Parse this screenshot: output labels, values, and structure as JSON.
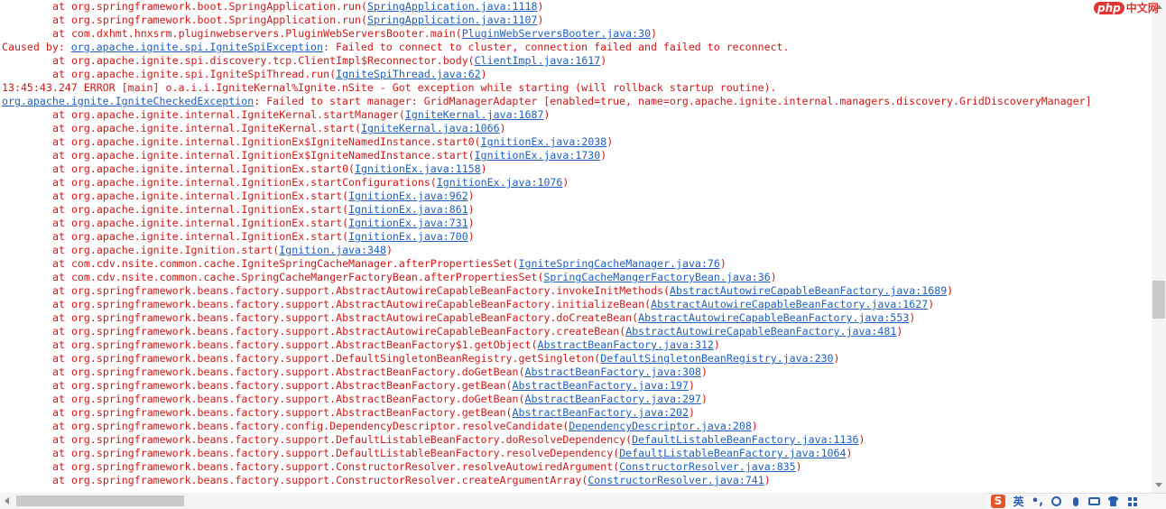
{
  "console": {
    "lines": [
      {
        "indent": true,
        "text": "at org.springframework.boot.SpringApplication.run(",
        "link": "SpringApplication.java:1118",
        "after": ")"
      },
      {
        "indent": true,
        "text": "at org.springframework.boot.SpringApplication.run(",
        "link": "SpringApplication.java:1107",
        "after": ")"
      },
      {
        "indent": true,
        "text": "at com.dxhmt.hnxsrm.pluginwebservers.PluginWebServersBooter.main(",
        "link": "PluginWebServersBooter.java:30",
        "after": ")"
      },
      {
        "indent": false,
        "text": "Caused by: ",
        "link": "org.apache.ignite.spi.IgniteSpiException",
        "after": ": Failed to connect to cluster, connection failed and failed to reconnect."
      },
      {
        "indent": true,
        "text": "at org.apache.ignite.spi.discovery.tcp.ClientImpl$Reconnector.body(",
        "link": "ClientImpl.java:1617",
        "after": ")"
      },
      {
        "indent": true,
        "text": "at org.apache.ignite.spi.IgniteSpiThread.run(",
        "link": "IgniteSpiThread.java:62",
        "after": ")"
      },
      {
        "indent": false,
        "text": "13:45:43.247 ERROR [main] o.a.i.i.IgniteKernal%Ignite.nSite - Got exception while starting (will rollback startup routine).",
        "link": "",
        "after": ""
      },
      {
        "indent": false,
        "text": "",
        "link": "org.apache.ignite.IgniteCheckedException",
        "after": ": Failed to start manager: GridManagerAdapter [enabled=true, name=org.apache.ignite.internal.managers.discovery.GridDiscoveryManager]"
      },
      {
        "indent": true,
        "text": "at org.apache.ignite.internal.IgniteKernal.startManager(",
        "link": "IgniteKernal.java:1687",
        "after": ")"
      },
      {
        "indent": true,
        "text": "at org.apache.ignite.internal.IgniteKernal.start(",
        "link": "IgniteKernal.java:1066",
        "after": ")"
      },
      {
        "indent": true,
        "text": "at org.apache.ignite.internal.IgnitionEx$IgniteNamedInstance.start0(",
        "link": "IgnitionEx.java:2038",
        "after": ")"
      },
      {
        "indent": true,
        "text": "at org.apache.ignite.internal.IgnitionEx$IgniteNamedInstance.start(",
        "link": "IgnitionEx.java:1730",
        "after": ")"
      },
      {
        "indent": true,
        "text": "at org.apache.ignite.internal.IgnitionEx.start0(",
        "link": "IgnitionEx.java:1158",
        "after": ")"
      },
      {
        "indent": true,
        "text": "at org.apache.ignite.internal.IgnitionEx.startConfigurations(",
        "link": "IgnitionEx.java:1076",
        "after": ")"
      },
      {
        "indent": true,
        "text": "at org.apache.ignite.internal.IgnitionEx.start(",
        "link": "IgnitionEx.java:962",
        "after": ")"
      },
      {
        "indent": true,
        "text": "at org.apache.ignite.internal.IgnitionEx.start(",
        "link": "IgnitionEx.java:861",
        "after": ")"
      },
      {
        "indent": true,
        "text": "at org.apache.ignite.internal.IgnitionEx.start(",
        "link": "IgnitionEx.java:731",
        "after": ")"
      },
      {
        "indent": true,
        "text": "at org.apache.ignite.internal.IgnitionEx.start(",
        "link": "IgnitionEx.java:700",
        "after": ")"
      },
      {
        "indent": true,
        "text": "at org.apache.ignite.Ignition.start(",
        "link": "Ignition.java:348",
        "after": ")"
      },
      {
        "indent": true,
        "text": "at com.cdv.nsite.common.cache.IgniteSpringCacheManager.afterPropertiesSet(",
        "link": "IgniteSpringCacheManager.java:76",
        "after": ")"
      },
      {
        "indent": true,
        "text": "at com.cdv.nsite.common.cache.SpringCacheMangerFactoryBean.afterPropertiesSet(",
        "link": "SpringCacheMangerFactoryBean.java:36",
        "after": ")"
      },
      {
        "indent": true,
        "text": "at org.springframework.beans.factory.support.AbstractAutowireCapableBeanFactory.invokeInitMethods(",
        "link": "AbstractAutowireCapableBeanFactory.java:1689",
        "after": ")"
      },
      {
        "indent": true,
        "text": "at org.springframework.beans.factory.support.AbstractAutowireCapableBeanFactory.initializeBean(",
        "link": "AbstractAutowireCapableBeanFactory.java:1627",
        "after": ")"
      },
      {
        "indent": true,
        "text": "at org.springframework.beans.factory.support.AbstractAutowireCapableBeanFactory.doCreateBean(",
        "link": "AbstractAutowireCapableBeanFactory.java:553",
        "after": ")"
      },
      {
        "indent": true,
        "text": "at org.springframework.beans.factory.support.AbstractAutowireCapableBeanFactory.createBean(",
        "link": "AbstractAutowireCapableBeanFactory.java:481",
        "after": ")"
      },
      {
        "indent": true,
        "text": "at org.springframework.beans.factory.support.AbstractBeanFactory$1.getObject(",
        "link": "AbstractBeanFactory.java:312",
        "after": ")"
      },
      {
        "indent": true,
        "text": "at org.springframework.beans.factory.support.DefaultSingletonBeanRegistry.getSingleton(",
        "link": "DefaultSingletonBeanRegistry.java:230",
        "after": ")"
      },
      {
        "indent": true,
        "text": "at org.springframework.beans.factory.support.AbstractBeanFactory.doGetBean(",
        "link": "AbstractBeanFactory.java:308",
        "after": ")"
      },
      {
        "indent": true,
        "text": "at org.springframework.beans.factory.support.AbstractBeanFactory.getBean(",
        "link": "AbstractBeanFactory.java:197",
        "after": ")"
      },
      {
        "indent": true,
        "text": "at org.springframework.beans.factory.support.AbstractBeanFactory.doGetBean(",
        "link": "AbstractBeanFactory.java:297",
        "after": ")"
      },
      {
        "indent": true,
        "text": "at org.springframework.beans.factory.support.AbstractBeanFactory.getBean(",
        "link": "AbstractBeanFactory.java:202",
        "after": ")"
      },
      {
        "indent": true,
        "text": "at org.springframework.beans.factory.config.DependencyDescriptor.resolveCandidate(",
        "link": "DependencyDescriptor.java:208",
        "after": ")"
      },
      {
        "indent": true,
        "text": "at org.springframework.beans.factory.support.DefaultListableBeanFactory.doResolveDependency(",
        "link": "DefaultListableBeanFactory.java:1136",
        "after": ")"
      },
      {
        "indent": true,
        "text": "at org.springframework.beans.factory.support.DefaultListableBeanFactory.resolveDependency(",
        "link": "DefaultListableBeanFactory.java:1064",
        "after": ")"
      },
      {
        "indent": true,
        "text": "at org.springframework.beans.factory.support.ConstructorResolver.resolveAutowiredArgument(",
        "link": "ConstructorResolver.java:835",
        "after": ")"
      },
      {
        "indent": true,
        "text": "at org.springframework.beans.factory.support.ConstructorResolver.createArgumentArray(",
        "link": "ConstructorResolver.java:741",
        "after": ")"
      }
    ]
  },
  "watermark": {
    "brand": "php",
    "site": "中文网"
  },
  "ime": {
    "logo": "S",
    "lang": "英",
    "punct": "•,"
  },
  "icons": {
    "vscroll_up": "chevron-up-icon",
    "vscroll_down": "chevron-down-icon",
    "hscroll_left": "chevron-left-icon",
    "ime_logo": "sogou-logo-icon",
    "ime_emoji": "smiley-icon",
    "ime_voice": "microphone-icon",
    "ime_keyboard": "keyboard-icon",
    "ime_skin": "shirt-icon",
    "ime_toolbox": "grid-icon"
  },
  "colors": {
    "error_text": "#d01818",
    "link": "#1f5fbf",
    "background": "#ffffff",
    "scrollbar": "#f4f4f4",
    "watermark_red": "#e03535",
    "ime_blue": "#2a5fb0"
  }
}
